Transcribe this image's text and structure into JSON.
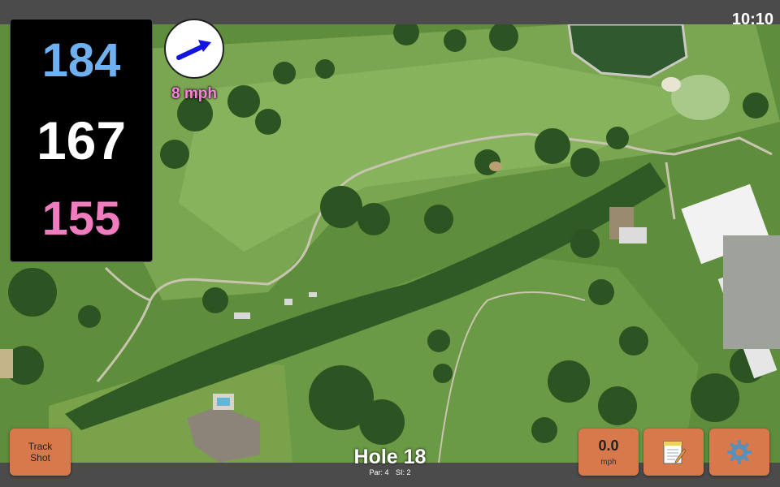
{
  "status_bar": {
    "time": "10:10"
  },
  "distances": {
    "back": "184",
    "center": "167",
    "front": "155"
  },
  "wind": {
    "speed": "8 mph",
    "arrow_color": "#1414e0"
  },
  "hole": {
    "title": "Hole 18",
    "par": "Par: 4",
    "stroke_index": "SI: 2"
  },
  "buttons": {
    "track_shot_line1": "Track",
    "track_shot_line2": "Shot",
    "speed_value": "0.0",
    "speed_unit": "mph",
    "notes_icon": "notepad-icon",
    "settings_icon": "gear-icon"
  },
  "colors": {
    "button_bg": "#d8794c",
    "back_distance": "#6fb0f0",
    "center_distance": "#ffffff",
    "front_distance": "#f07cc0",
    "wind_text": "#ff80e0"
  }
}
